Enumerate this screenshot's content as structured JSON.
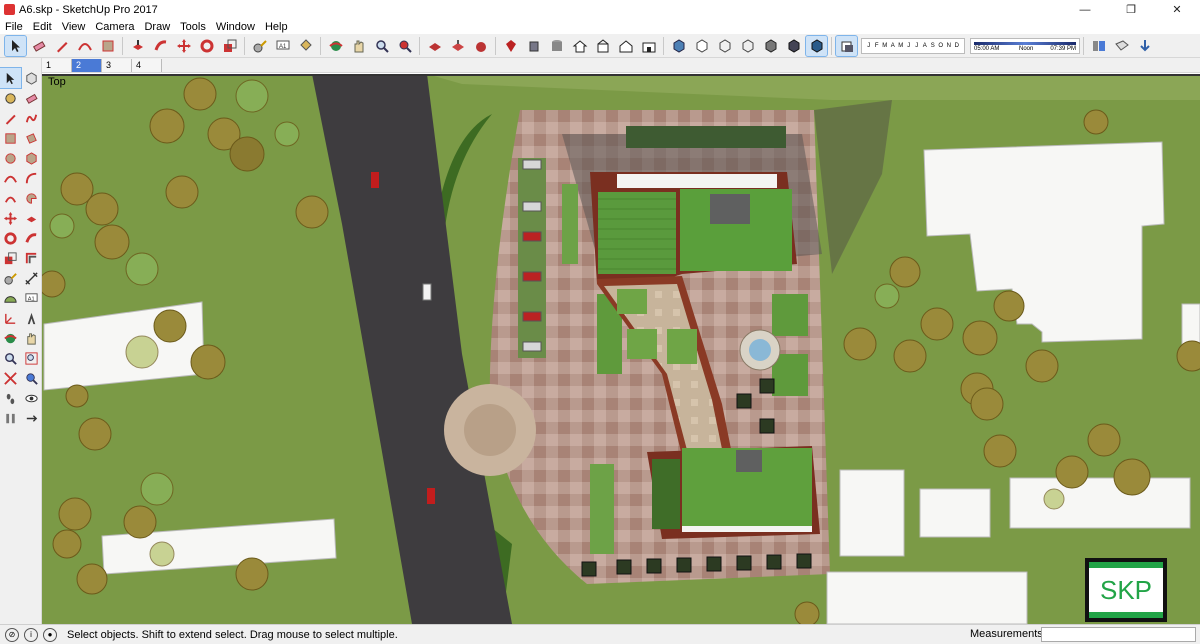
{
  "window": {
    "title": "A6.skp - SketchUp Pro 2017",
    "controls": {
      "minimize": "—",
      "restore": "❐",
      "close": "✕"
    }
  },
  "menu": [
    "File",
    "Edit",
    "View",
    "Camera",
    "Draw",
    "Tools",
    "Window",
    "Help"
  ],
  "toolbar": {
    "shadow_months": [
      "J",
      "F",
      "M",
      "A",
      "M",
      "J",
      "J",
      "A",
      "S",
      "O",
      "N",
      "D"
    ],
    "time_start": "05:00 AM",
    "time_noon": "Noon",
    "time_end": "07:39 PM"
  },
  "scenes": {
    "tabs": [
      "1",
      "2",
      "3",
      "4"
    ],
    "selected": "2"
  },
  "viewport": {
    "view_name": "Top",
    "logo_text": "SKP"
  },
  "status": {
    "hint": "Select objects. Shift to extend select. Drag mouse to select multiple.",
    "measurements_label": "Measurements",
    "measurements_value": ""
  },
  "colors": {
    "grass": "#7d9a48",
    "road": "#3e3c3f",
    "paving": "#b48e86",
    "green_roof": "#4e9b3c",
    "building_white": "#f7f7f5",
    "accent_selection": "#4a7ad6",
    "logo_green": "#22a447"
  }
}
